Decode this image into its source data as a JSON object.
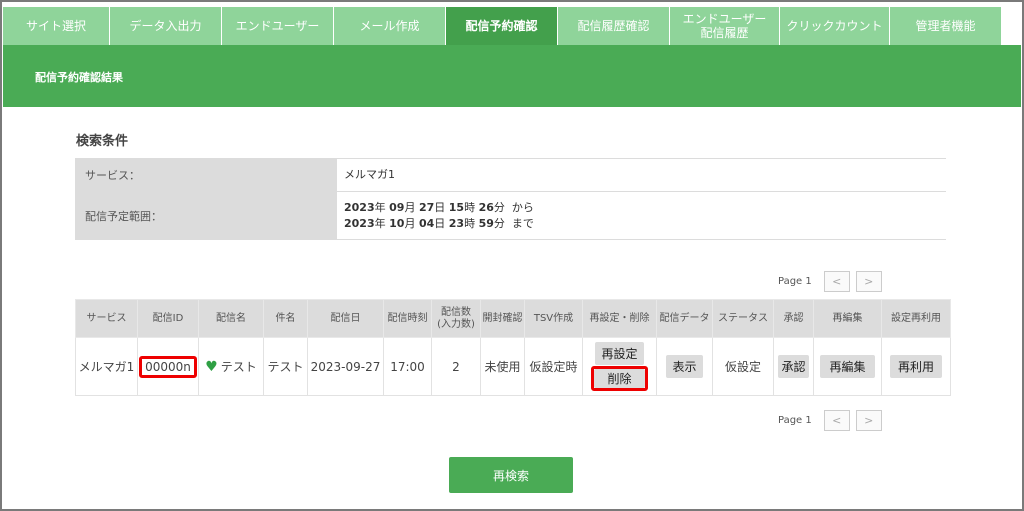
{
  "tabs": [
    {
      "label": "サイト選択",
      "active": false
    },
    {
      "label": "データ入出力",
      "active": false
    },
    {
      "label": "エンドユーザー",
      "active": false
    },
    {
      "label": "メール作成",
      "active": false
    },
    {
      "label": "配信予約確認",
      "active": true
    },
    {
      "label": "配信履歴確認",
      "active": false
    },
    {
      "label": "エンドユーザー\n配信履歴",
      "active": false
    },
    {
      "label": "クリックカウント",
      "active": false
    },
    {
      "label": "管理者機能",
      "active": false
    }
  ],
  "header": {
    "title": "配信予約確認結果"
  },
  "search": {
    "title": "検索条件",
    "service_label": "サービス：",
    "service_value": "メルマガ1",
    "range_label": "配信予定範囲：",
    "from": {
      "year": "2023",
      "y": "年",
      "month": "09",
      "m": "月",
      "day": "27",
      "d": "日",
      "hour": "15",
      "h": "時",
      "min": "26",
      "mi": "分",
      "suffix": "から"
    },
    "to": {
      "year": "2023",
      "y": "年",
      "month": "10",
      "m": "月",
      "day": "04",
      "d": "日",
      "hour": "23",
      "h": "時",
      "min": "59",
      "mi": "分",
      "suffix": "まで"
    }
  },
  "pager": {
    "label": "Page 1",
    "prev": "<",
    "next": ">"
  },
  "results": {
    "headers": [
      "サービス",
      "配信ID",
      "配信名",
      "件名",
      "配信日",
      "配信時刻",
      "配信数\n(入力数)",
      "開封確認",
      "TSV作成",
      "再設定・削除",
      "配信データ",
      "ステータス",
      "承認",
      "再編集",
      "設定再利用"
    ],
    "row": {
      "service": "メルマガ1",
      "id": "00000n",
      "name": "テスト",
      "subject": "テスト",
      "date": "2023-09-27",
      "time": "17:00",
      "count": "2",
      "open": "未使用",
      "tsv": "仮設定時",
      "reset_btn": "再設定",
      "delete_btn": "削除",
      "show_btn": "表示",
      "status": "仮設定",
      "approve_btn": "承認",
      "reedit_btn": "再編集",
      "reuse_btn": "再利用"
    }
  },
  "research_button": "再検索",
  "colors": {
    "tab": "#8fd49a",
    "tab_active": "#43a04c",
    "band": "#4aab55",
    "highlight": "#ee0000"
  }
}
